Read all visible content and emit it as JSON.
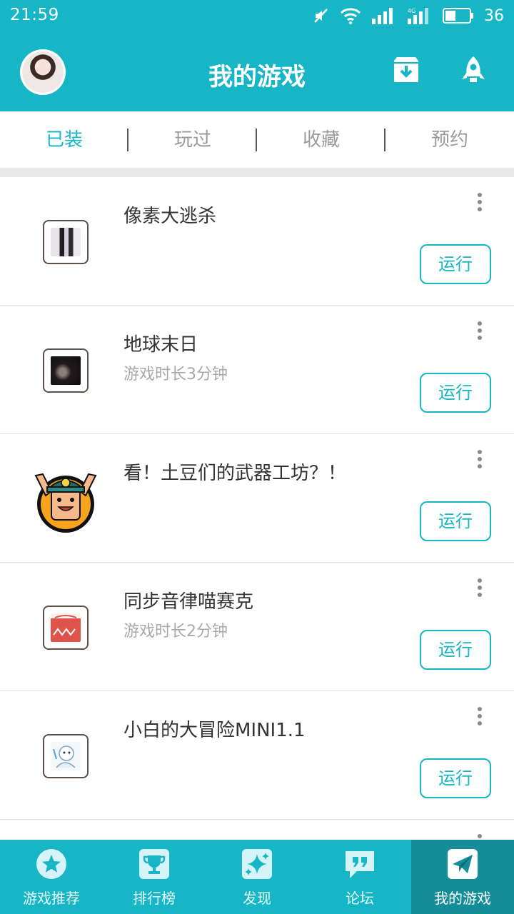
{
  "status_bar": {
    "time": "21:59",
    "battery": "36"
  },
  "header": {
    "title": "我的游戏"
  },
  "tabs": [
    {
      "label": "已装",
      "active": true
    },
    {
      "label": "玩过",
      "active": false
    },
    {
      "label": "收藏",
      "active": false
    },
    {
      "label": "预约",
      "active": false
    }
  ],
  "games": [
    {
      "name": "像素大逃杀",
      "playtime": "",
      "action": "运行",
      "icon": "pixel-battle-icon"
    },
    {
      "name": "地球末日",
      "playtime": "游戏时长3分钟",
      "action": "运行",
      "icon": "earth-doomsday-icon"
    },
    {
      "name": "看！土豆们的武器工坊？！",
      "playtime": "",
      "action": "运行",
      "icon": "potato-mascot-icon"
    },
    {
      "name": "同步音律喵赛克",
      "playtime": "游戏时长2分钟",
      "action": "运行",
      "icon": "cytus-cat-icon"
    },
    {
      "name": "小白的大冒险MINI1.1",
      "playtime": "",
      "action": "运行",
      "icon": "xiaobai-adventure-icon"
    }
  ],
  "bottom_nav": [
    {
      "label": "游戏推荐",
      "icon": "star-icon",
      "active": false
    },
    {
      "label": "排行榜",
      "icon": "trophy-icon",
      "active": false
    },
    {
      "label": "发现",
      "icon": "sparkle-icon",
      "active": false
    },
    {
      "label": "论坛",
      "icon": "quote-bubble-icon",
      "active": false
    },
    {
      "label": "我的游戏",
      "icon": "paper-plane-icon",
      "active": true
    }
  ],
  "colors": {
    "accent": "#17b6c6",
    "active_nav": "#148d99"
  }
}
